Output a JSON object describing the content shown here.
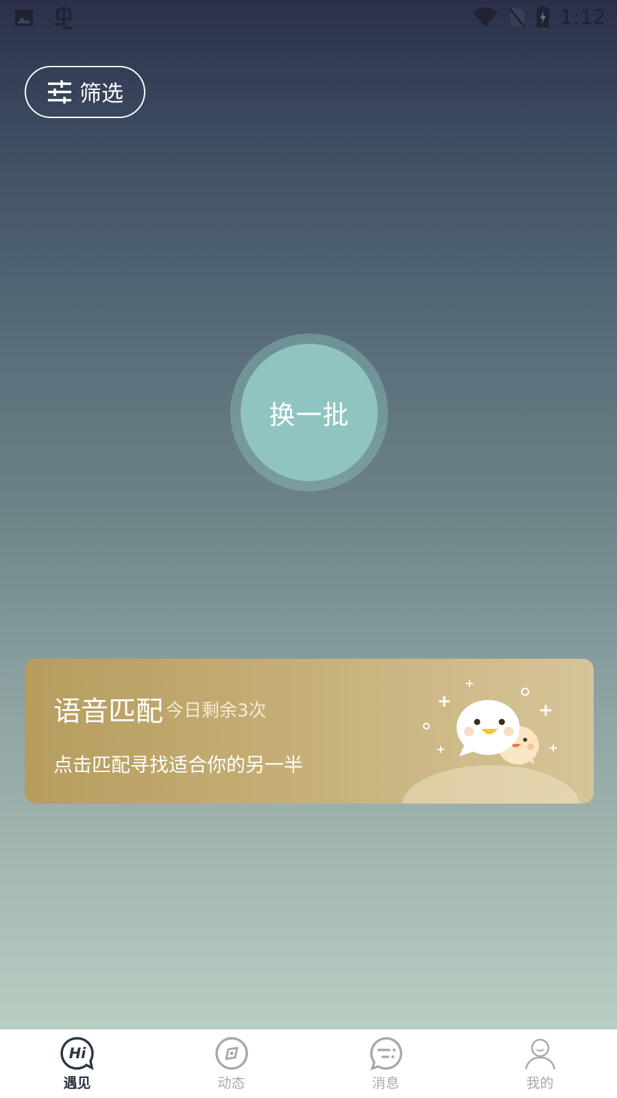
{
  "status_bar": {
    "time": "1:12",
    "left_icons": [
      "image-icon",
      "app-logo-icon"
    ],
    "right_icons": [
      "wifi-icon",
      "no-sim-icon",
      "battery-charging-icon"
    ]
  },
  "filter": {
    "label": "筛选",
    "icon": "sliders-icon"
  },
  "refresh": {
    "label": "换一批"
  },
  "voice_match": {
    "title": "语音匹配",
    "remaining": "今日剩余3次",
    "subtitle": "点击匹配寻找适合你的另一半"
  },
  "bottom_nav": {
    "items": [
      {
        "label": "遇见",
        "icon": "hi-chat-icon",
        "active": true
      },
      {
        "label": "动态",
        "icon": "compass-icon",
        "active": false
      },
      {
        "label": "消息",
        "icon": "message-icon",
        "active": false
      },
      {
        "label": "我的",
        "icon": "user-icon",
        "active": false
      }
    ]
  },
  "colors": {
    "refresh_button": "#90c4c0",
    "card_start": "#b69d5f",
    "card_end": "#d6c599",
    "nav_active": "#2d3544",
    "nav_inactive": "#a8a8a8"
  }
}
